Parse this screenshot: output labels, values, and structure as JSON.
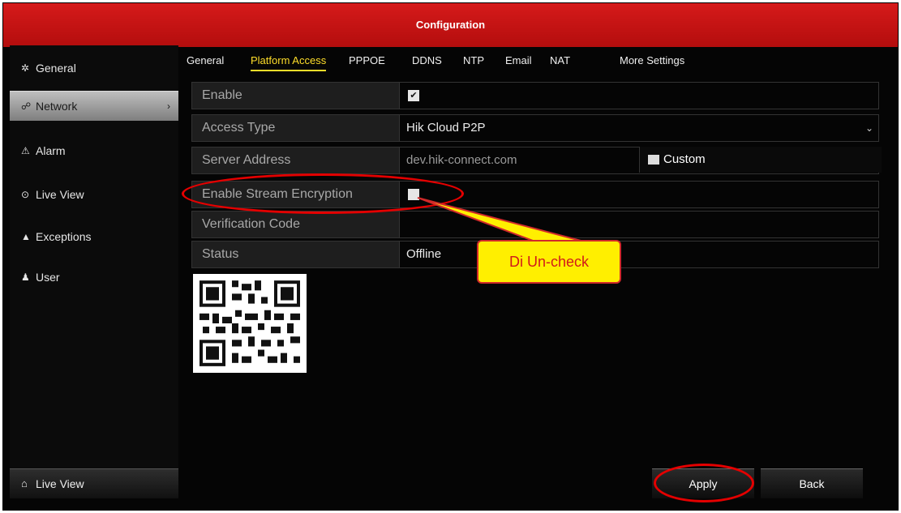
{
  "window": {
    "title": "Configuration"
  },
  "sidebar": {
    "items": [
      {
        "label": "General",
        "icon": "gear-icon"
      },
      {
        "label": "Network",
        "icon": "network-icon"
      },
      {
        "label": "Alarm",
        "icon": "alarm-icon"
      },
      {
        "label": "Live View",
        "icon": "eye-icon"
      },
      {
        "label": "Exceptions",
        "icon": "warning-icon"
      },
      {
        "label": "User",
        "icon": "users-icon"
      }
    ],
    "active": "Network",
    "footer": {
      "label": "Live View",
      "icon": "home-icon"
    }
  },
  "tabs": [
    "General",
    "Platform Access",
    "PPPOE",
    "DDNS",
    "NTP",
    "Email",
    "NAT",
    "More Settings"
  ],
  "active_tab": "Platform Access",
  "form": {
    "enable": {
      "label": "Enable",
      "checked": true
    },
    "access_type": {
      "label": "Access Type",
      "value": "Hik Cloud P2P"
    },
    "server_address": {
      "label": "Server Address",
      "value": "dev.hik-connect.com",
      "custom_label": "Custom",
      "custom_checked": false
    },
    "stream_encryption": {
      "label": "Enable Stream Encryption",
      "checked": false
    },
    "verification_code": {
      "label": "Verification Code",
      "value": ""
    },
    "status": {
      "label": "Status",
      "value": "Offline"
    }
  },
  "buttons": {
    "apply": "Apply",
    "back": "Back"
  },
  "annotation": {
    "callout_text": "Di Un-check"
  },
  "colors": {
    "titlebar": "#c41010",
    "active_tab": "#ffde2a",
    "annotation_red": "#e40000",
    "callout_fill": "#ffef00"
  }
}
